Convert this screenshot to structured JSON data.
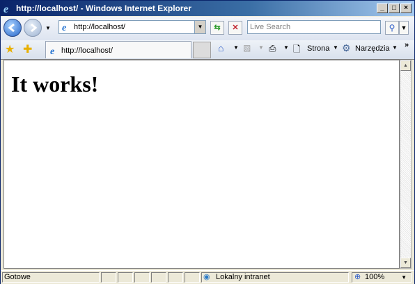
{
  "window": {
    "title": "http://localhost/ - Windows Internet Explorer"
  },
  "nav": {
    "address": "http://localhost/",
    "search_placeholder": "Live Search"
  },
  "tab": {
    "title": "http://localhost/"
  },
  "toolbar": {
    "page_label": "Strona",
    "tools_label": "Narzędzia",
    "more": "»"
  },
  "content": {
    "heading": "It works!"
  },
  "statusbar": {
    "status": "Gotowe",
    "zone": "Lokalny intranet",
    "zoom": "100%"
  },
  "icons": [
    "ie-logo-icon",
    "back-icon",
    "forward-icon",
    "refresh-icon",
    "stop-icon",
    "search-icon",
    "favorites-star-icon",
    "add-favorites-icon",
    "home-icon",
    "rss-icon",
    "print-icon",
    "page-icon",
    "tools-gear-icon",
    "intranet-icon",
    "zoom-icon"
  ],
  "colors": {
    "titlebar_start": "#0a246a",
    "titlebar_end": "#a6caf0",
    "content_bg": "#ffffff"
  }
}
